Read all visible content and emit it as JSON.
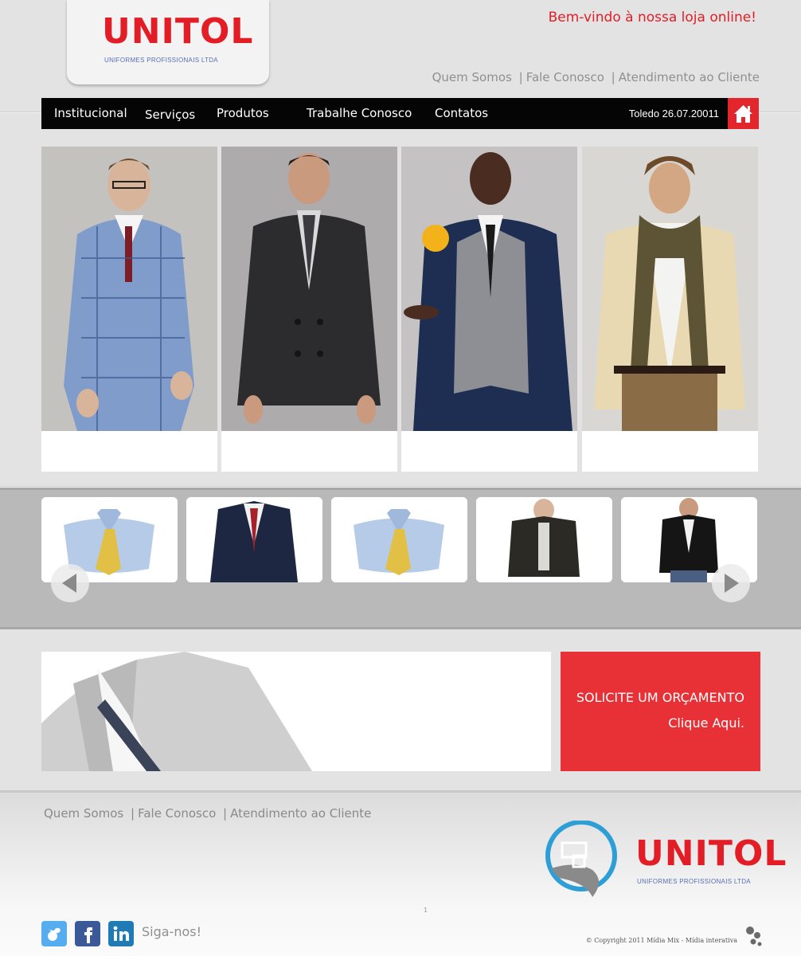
{
  "brand": {
    "logo_word": "UNITOL",
    "logo_sub": "UNIFORMES PROFISSIONAIS LTDA",
    "accent": "#e21d26",
    "sub_color": "#5a6fb4"
  },
  "header": {
    "welcome": "Bem-vindo à nossa loja online!",
    "links": [
      "Quem Somos",
      "Fale Conosco",
      "Atendimento ao Cliente"
    ]
  },
  "nav": {
    "items": [
      "Institucional",
      "Serviços",
      "Produtos",
      "Trabalhe Conosco",
      "Contatos"
    ],
    "date": "Toledo 26.07.20011",
    "home_icon": "home-icon"
  },
  "hero": {
    "cards": [
      {
        "description": "model-plaid-suit"
      },
      {
        "description": "model-dark-overcoat"
      },
      {
        "description": "model-cardigan-vest"
      },
      {
        "description": "model-scarf-cardigan"
      }
    ]
  },
  "carousel": {
    "products": [
      "blue-shirt-tie",
      "navy-blazer",
      "blue-shirt-tie",
      "brown-jacket",
      "black-leather-jacket"
    ],
    "prev_icon": "chevron-left-icon",
    "next_icon": "chevron-right-icon"
  },
  "banner": {
    "cta_line1": "SOLICITE UM ORÇAMENTO",
    "cta_line2": "Clique Aqui.",
    "cta_color": "#e73136"
  },
  "footer": {
    "links": [
      "Quem Somos",
      "Fale Conosco",
      "Atendimento ao Cliente"
    ],
    "follow": "Siga-nos!",
    "social_icons": [
      "twitter-icon",
      "facebook-icon",
      "linkedin-icon"
    ],
    "copyright": "© Copyright 2011 Mídia Mix - Mídia interativa",
    "tiny_mark": "1"
  }
}
